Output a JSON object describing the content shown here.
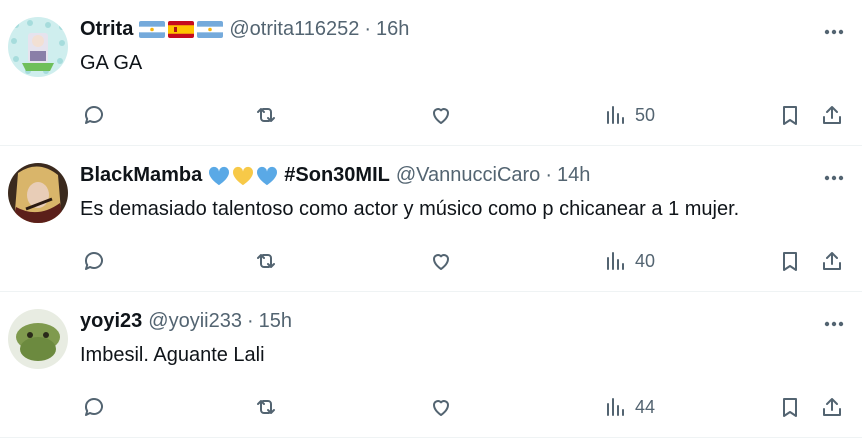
{
  "colors": {
    "text": "#0f1419",
    "muted": "#536471",
    "divider": "#eff3f4",
    "heart_blue": "#5aa9e6",
    "heart_yellow": "#f7c948"
  },
  "tweets": [
    {
      "name": "Otrita",
      "flags": [
        "argentina-flag",
        "spain-flag",
        "argentina-flag"
      ],
      "handle": "@otrita116252",
      "dot": "·",
      "time": "16h",
      "text": "GA GA",
      "views": "50"
    },
    {
      "name_prefix": "BlackMamba",
      "hearts": [
        "blue-heart-icon",
        "yellow-heart-icon",
        "blue-heart-icon"
      ],
      "name_suffix": "#Son30MIL",
      "handle": "@VannucciCaro",
      "dot": "·",
      "time": "14h",
      "text": "Es demasiado talentoso  como actor y músico como p chicanear a 1 mujer.",
      "views": "40"
    },
    {
      "name": "yoyi23",
      "handle": "@yoyii233",
      "dot": "·",
      "time": "15h",
      "text": "Imbesil. Aguante Lali",
      "views": "44"
    }
  ]
}
